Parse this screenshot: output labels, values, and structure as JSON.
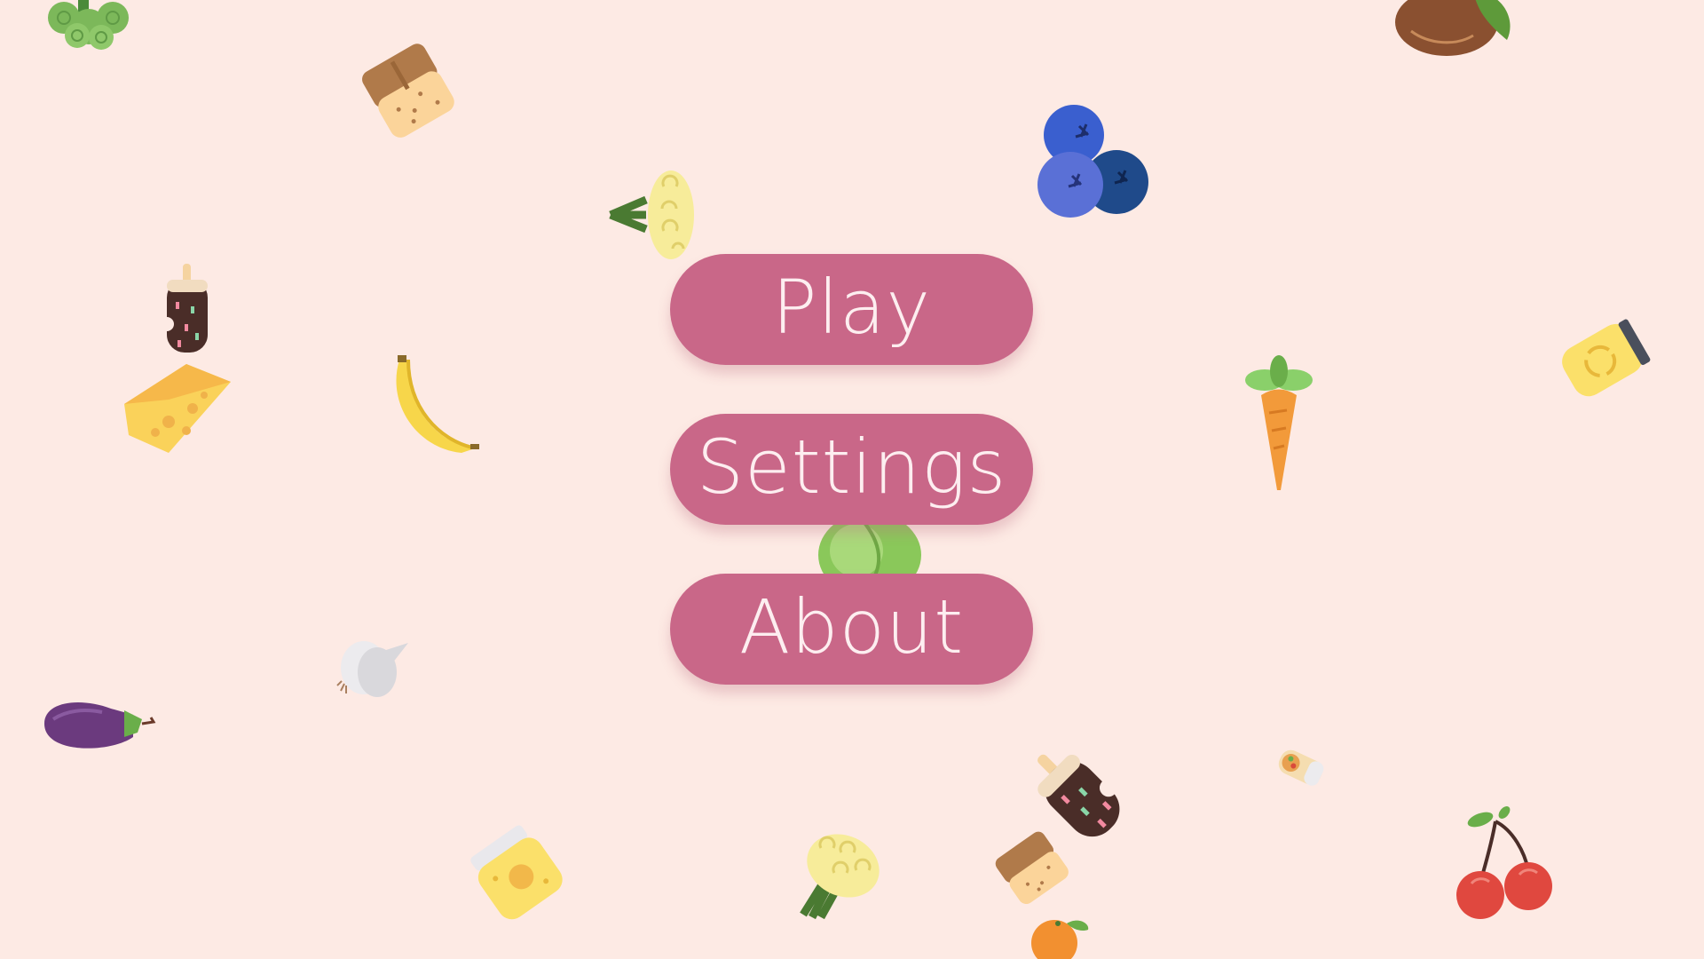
{
  "menu": {
    "play_label": "Play",
    "settings_label": "Settings",
    "about_label": "About"
  },
  "background": {
    "color": "#fdeae4",
    "decorations": [
      "broccoli-icon",
      "wafer-bar-icon",
      "cauliflower-icon",
      "blueberries-icon",
      "hazelnut-icon",
      "popsicle-icon",
      "cheese-icon",
      "banana-icon",
      "carrot-icon",
      "honey-jar-icon",
      "lettuce-icon",
      "garlic-icon",
      "eggplant-icon",
      "honey-jar-icon",
      "cauliflower-icon",
      "wafer-bar-icon",
      "popsicle-icon",
      "orange-icon",
      "burrito-icon",
      "cherries-icon"
    ]
  },
  "colors": {
    "button": "#c96788",
    "button_text": "#fdeef0"
  }
}
